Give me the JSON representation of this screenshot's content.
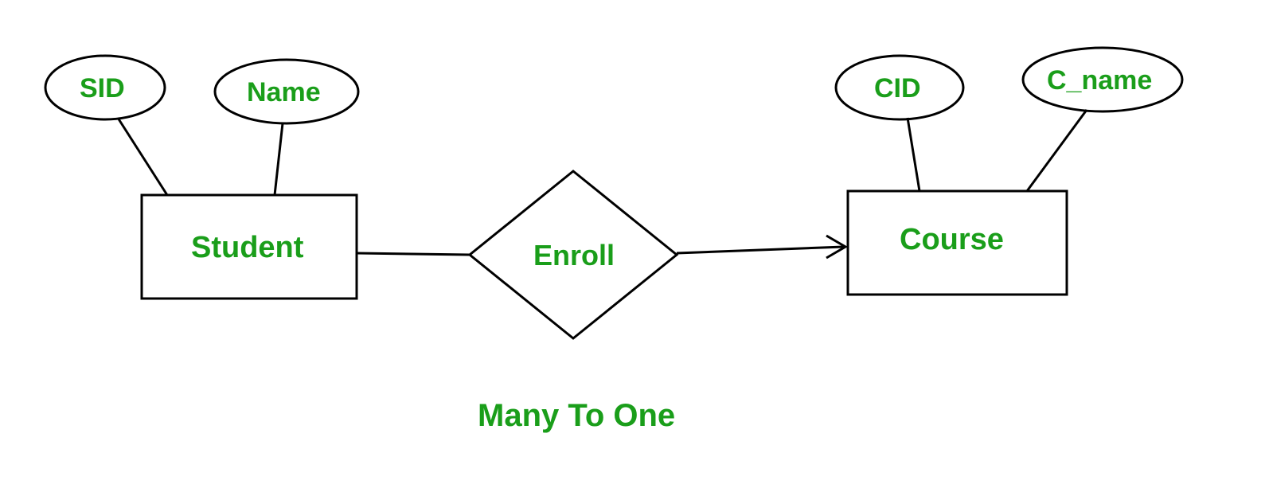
{
  "diagram": {
    "type": "ER Diagram",
    "caption": "Many To One",
    "entities": [
      {
        "name": "Student",
        "attributes": [
          "SID",
          "Name"
        ]
      },
      {
        "name": "Course",
        "attributes": [
          "CID",
          "C_name"
        ]
      }
    ],
    "relationship": {
      "name": "Enroll",
      "from": "Student",
      "to": "Course",
      "cardinality": "Many To One"
    },
    "labels": {
      "student_entity": "Student",
      "course_entity": "Course",
      "enroll_relationship": "Enroll",
      "sid_attr": "SID",
      "name_attr": "Name",
      "cid_attr": "CID",
      "cname_attr": "C_name",
      "caption_text": "Many To One"
    }
  }
}
